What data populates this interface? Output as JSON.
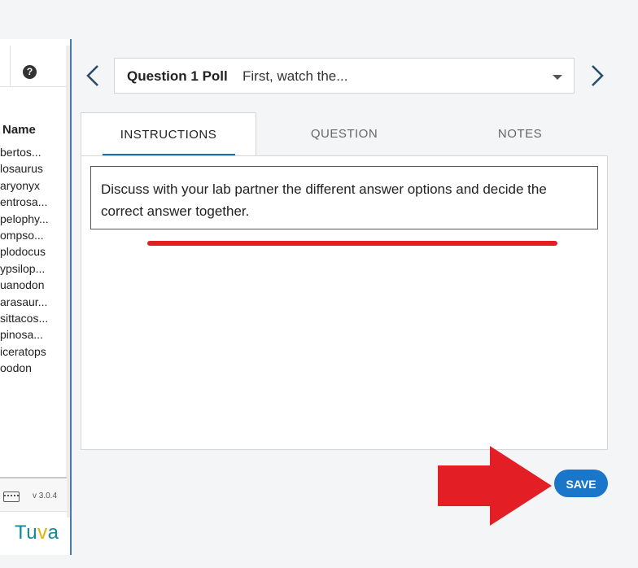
{
  "left_panel": {
    "column_header": "Name",
    "names": [
      "bertos...",
      "losaurus",
      "aryonyx",
      "entrosa...",
      "pelophy...",
      "ompso...",
      "plodocus",
      "ypsilop...",
      "uanodon",
      "arasaur...",
      "sittacos...",
      "pinosa...",
      "iceratops",
      "oodon"
    ],
    "help_icon": "question-circle-icon",
    "version": "v 3.0.4",
    "keyboard_icon": "keyboard-icon",
    "logo": {
      "prefix": "Tu",
      "highlight": "v",
      "suffix": "a"
    }
  },
  "question_nav": {
    "title": "Question 1 Poll",
    "subtitle": "First, watch the..."
  },
  "tabs": [
    {
      "label": "INSTRUCTIONS",
      "active": true
    },
    {
      "label": "QUESTION",
      "active": false
    },
    {
      "label": "NOTES",
      "active": false
    }
  ],
  "instructions": {
    "text": "Discuss with your lab partner the different answer options and decide the correct answer together."
  },
  "save_label": "SAVE",
  "colors": {
    "accent": "#1976c8",
    "annotation_red": "#e31e24",
    "panel_border": "#4a78a8"
  }
}
